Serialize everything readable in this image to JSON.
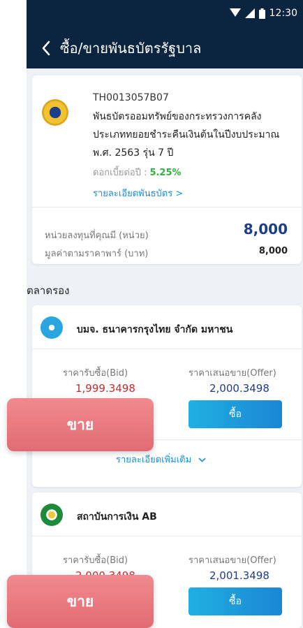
{
  "status_bar": {
    "time": "12:30",
    "icons": [
      "wifi-icon",
      "signal-icon",
      "battery-icon"
    ]
  },
  "header": {
    "title": "ซื้อ/ขายพันธบัตรรัฐบาล",
    "back_icon": "chevron-left-icon"
  },
  "bond": {
    "code": "TH0013057B07",
    "name": "พันธบัตรออมทรัพย์ของกระทรวงการคลังประเภททยอยชำระคืนเงินต้นในปีงบประมาณ พ.ศ. 2563 รุ่น 7 ปี",
    "interest_label": "ดอกเบี้ยต่อปี :",
    "interest_rate": "5.25%",
    "detail_link": "รายละเอียดพันธบัตร >",
    "units_label": "หน่วยลงทุนที่คุณมี (หน่วย)",
    "units_value": "8,000",
    "par_label": "มูลค่าตามราคาพาร์ (บาท)",
    "par_value": "8,000"
  },
  "secondary_market": {
    "title": "ตลาดรอง",
    "dealers": [
      {
        "name": "บมจ. ธนาคารกรุงไทย จำกัด มหาชน",
        "bid_label": "ราคารับซื้อ(Bid)",
        "bid_value": "1,999.3498",
        "offer_label": "ราคาเสนอขาย(Offer)",
        "offer_value": "2,000.3498",
        "buy_label": "ซื้อ",
        "sell_label": "ขาย",
        "more_label": "รายละเอียดเพิ่มเติม"
      },
      {
        "name": "สถาบันการเงิน AB",
        "bid_label": "ราคารับซื้อ(Bid)",
        "bid_value": "2,000.3498",
        "offer_label": "ราคาเสนอขาย(Offer)",
        "offer_value": "2,001.3498",
        "buy_label": "ซื้อ",
        "sell_label": "ขาย"
      }
    ]
  },
  "colors": {
    "header_bg": "#0b2540",
    "bid_red": "#c62c2c",
    "offer_blue": "#1c3d8c",
    "link_blue": "#1b8fd6",
    "rate_green": "#2db53a",
    "sell_pink": "#e26b73",
    "buy_blue": "#1b86d4"
  }
}
